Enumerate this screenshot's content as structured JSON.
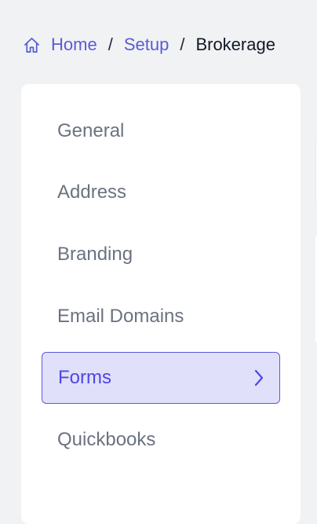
{
  "breadcrumb": {
    "home_icon": "home-icon",
    "items": [
      {
        "label": "Home"
      },
      {
        "label": "Setup"
      },
      {
        "label": "Brokerage"
      }
    ],
    "separator": "/"
  },
  "sidebar": {
    "items": [
      {
        "label": "General"
      },
      {
        "label": "Address"
      },
      {
        "label": "Branding"
      },
      {
        "label": "Email Domains"
      },
      {
        "label": "Forms",
        "active": true,
        "icon": "chevron-right-icon"
      },
      {
        "label": "Quickbooks"
      }
    ]
  },
  "colors": {
    "accent": "#5b5bd6",
    "active_bg": "#e0e0fa",
    "text_muted": "#6b7280",
    "page_bg": "#f1f2f4"
  }
}
